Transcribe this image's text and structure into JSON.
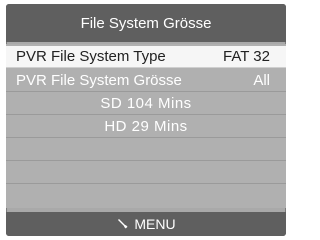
{
  "window": {
    "title": "File System Grösse"
  },
  "rows": [
    {
      "label": "PVR File System Type",
      "value": "FAT 32"
    },
    {
      "label": "PVR File System Grösse",
      "value": "All"
    }
  ],
  "info": {
    "sd": "SD  104  Mins",
    "hd": "HD  29  Mins"
  },
  "footer": {
    "icon": "remote-icon",
    "label": "MENU"
  }
}
